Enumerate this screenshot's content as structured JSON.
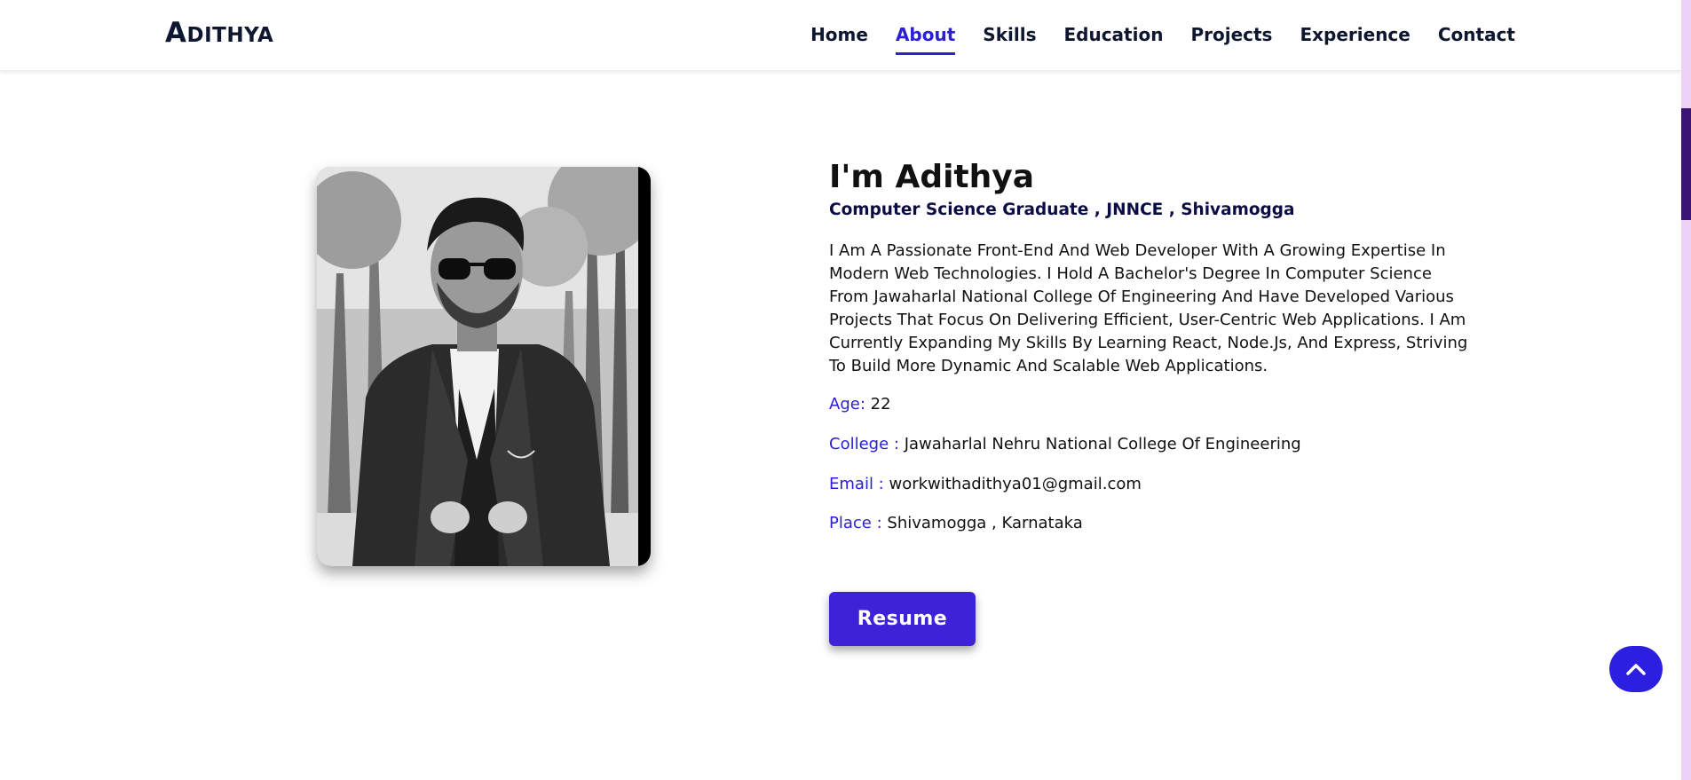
{
  "header": {
    "logo_cap": "A",
    "logo_rest": "DITHYA",
    "nav": [
      {
        "label": "Home",
        "active": false
      },
      {
        "label": "About",
        "active": true
      },
      {
        "label": "Skills",
        "active": false
      },
      {
        "label": "Education",
        "active": false
      },
      {
        "label": "Projects",
        "active": false
      },
      {
        "label": "Experience",
        "active": false
      },
      {
        "label": "Contact",
        "active": false
      }
    ]
  },
  "about": {
    "heading": "I'm Adithya",
    "subheading": "Computer Science Graduate , JNNCE , Shivamogga",
    "bio": "I Am A Passionate Front-End And Web Developer With A Growing Expertise In Modern Web Technologies. I Hold A Bachelor's Degree In Computer Science From Jawaharlal National College Of Engineering And Have Developed Various Projects That Focus On Delivering Efficient, User-Centric Web Applications. I Am Currently Expanding My Skills By Learning React, Node.Js, And Express, Striving To Build More Dynamic And Scalable Web Applications.",
    "info": [
      {
        "label": "Age:",
        "value": "22"
      },
      {
        "label": "College :",
        "value": "Jawaharlal Nehru National College Of Engineering"
      },
      {
        "label": "Email :",
        "value": "workwithadithya01@gmail.com"
      },
      {
        "label": "Place :",
        "value": "Shivamogga , Karnataka"
      }
    ],
    "resume_label": "Resume"
  },
  "icons": {
    "scroll_top": "chevron-up-icon"
  },
  "colors": {
    "accent": "#2b20d6",
    "button": "#3c23d8",
    "text": "#111111",
    "nav_text": "#0e1630"
  }
}
